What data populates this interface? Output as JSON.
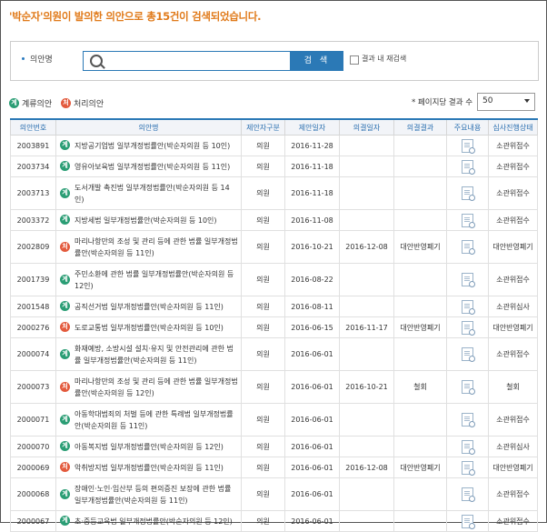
{
  "headline": {
    "name": "'박순자'",
    "text_mid": "의원이 발의한 의안으로 총",
    "count": "15건",
    "text_end": "이 검색되었습니다."
  },
  "search": {
    "label": "의안명",
    "value": "",
    "button": "검 색",
    "recheck_label": "결과 내 재검색"
  },
  "legend": {
    "pending": "계류의안",
    "processed": "처리의안"
  },
  "paging": {
    "label": "* 페이지당 결과 수",
    "selected": "50"
  },
  "badges": {
    "pending": "계",
    "processed": "처"
  },
  "table": {
    "headers": [
      "의안번호",
      "의안명",
      "제안자구분",
      "제안일자",
      "의결일자",
      "의결결과",
      "주요내용",
      "심사진행상태"
    ],
    "rows": [
      {
        "no": "2003891",
        "status": "pending",
        "name": "지방공기업법 일부개정법률안(박순자의원 등 10인)",
        "proposer": "의원",
        "date": "2016-11-28",
        "decided": "",
        "result": "",
        "stage": "소관위접수"
      },
      {
        "no": "2003734",
        "status": "pending",
        "name": "영유아보육법 일부개정법률안(박순자의원 등 11인)",
        "proposer": "의원",
        "date": "2016-11-18",
        "decided": "",
        "result": "",
        "stage": "소관위접수"
      },
      {
        "no": "2003713",
        "status": "pending",
        "name": "도서개발 촉진법 일부개정법률안(박순자의원 등 14인)",
        "proposer": "의원",
        "date": "2016-11-18",
        "decided": "",
        "result": "",
        "stage": "소관위접수"
      },
      {
        "no": "2003372",
        "status": "pending",
        "name": "지방세법 일부개정법률안(박순자의원 등 10인)",
        "proposer": "의원",
        "date": "2016-11-08",
        "decided": "",
        "result": "",
        "stage": "소관위접수"
      },
      {
        "no": "2002809",
        "status": "processed",
        "name": "마리나항만의 조성 및 관리 등에 관한 법률 일부개정법률안(박순자의원 등 11인)",
        "proposer": "의원",
        "date": "2016-10-21",
        "decided": "2016-12-08",
        "result": "대안반영폐기",
        "stage": "대안반영폐기"
      },
      {
        "no": "2001739",
        "status": "pending",
        "name": "주민소환에 관한 법률 일부개정법률안(박순자의원 등 12인)",
        "proposer": "의원",
        "date": "2016-08-22",
        "decided": "",
        "result": "",
        "stage": "소관위접수"
      },
      {
        "no": "2001548",
        "status": "pending",
        "name": "공직선거법 일부개정법률안(박순자의원 등 11인)",
        "proposer": "의원",
        "date": "2016-08-11",
        "decided": "",
        "result": "",
        "stage": "소관위심사"
      },
      {
        "no": "2000276",
        "status": "processed",
        "name": "도로교통법 일부개정법률안(박순자의원 등 10인)",
        "proposer": "의원",
        "date": "2016-06-15",
        "decided": "2016-11-17",
        "result": "대안반영폐기",
        "stage": "대안반영폐기"
      },
      {
        "no": "2000074",
        "status": "pending",
        "name": "화재예방, 소방시설 설치·유지 및 안전관리에 관한 법률 일부개정법률안(박순자의원 등 11인)",
        "proposer": "의원",
        "date": "2016-06-01",
        "decided": "",
        "result": "",
        "stage": "소관위접수"
      },
      {
        "no": "2000073",
        "status": "processed",
        "name": "마리나항만의 조성 및 관리 등에 관한 법률 일부개정법률안(박순자의원 등 12인)",
        "proposer": "의원",
        "date": "2016-06-01",
        "decided": "2016-10-21",
        "result": "철회",
        "stage": "철회"
      },
      {
        "no": "2000071",
        "status": "pending",
        "name": "아동학대범죄의 처벌 등에 관한 특례법 일부개정법률안(박순자의원 등 11인)",
        "proposer": "의원",
        "date": "2016-06-01",
        "decided": "",
        "result": "",
        "stage": "소관위접수"
      },
      {
        "no": "2000070",
        "status": "pending",
        "name": "아동복지법 일부개정법률안(박순자의원 등 12인)",
        "proposer": "의원",
        "date": "2016-06-01",
        "decided": "",
        "result": "",
        "stage": "소관위심사"
      },
      {
        "no": "2000069",
        "status": "processed",
        "name": "악취방지법 일부개정법률안(박순자의원 등 11인)",
        "proposer": "의원",
        "date": "2016-06-01",
        "decided": "2016-12-08",
        "result": "대안반영폐기",
        "stage": "대안반영폐기"
      },
      {
        "no": "2000068",
        "status": "pending",
        "name": "장애인·노인·임산부 등의 편의증진 보장에 관한 법률 일부개정법률안(박순자의원 등 11인)",
        "proposer": "의원",
        "date": "2016-06-01",
        "decided": "",
        "result": "",
        "stage": "소관위접수"
      },
      {
        "no": "2000067",
        "status": "pending",
        "name": "초·중등교육법 일부개정법률안(박순자의원 등 12인)",
        "proposer": "의원",
        "date": "2016-06-01",
        "decided": "",
        "result": "",
        "stage": "소관위접수"
      }
    ]
  }
}
